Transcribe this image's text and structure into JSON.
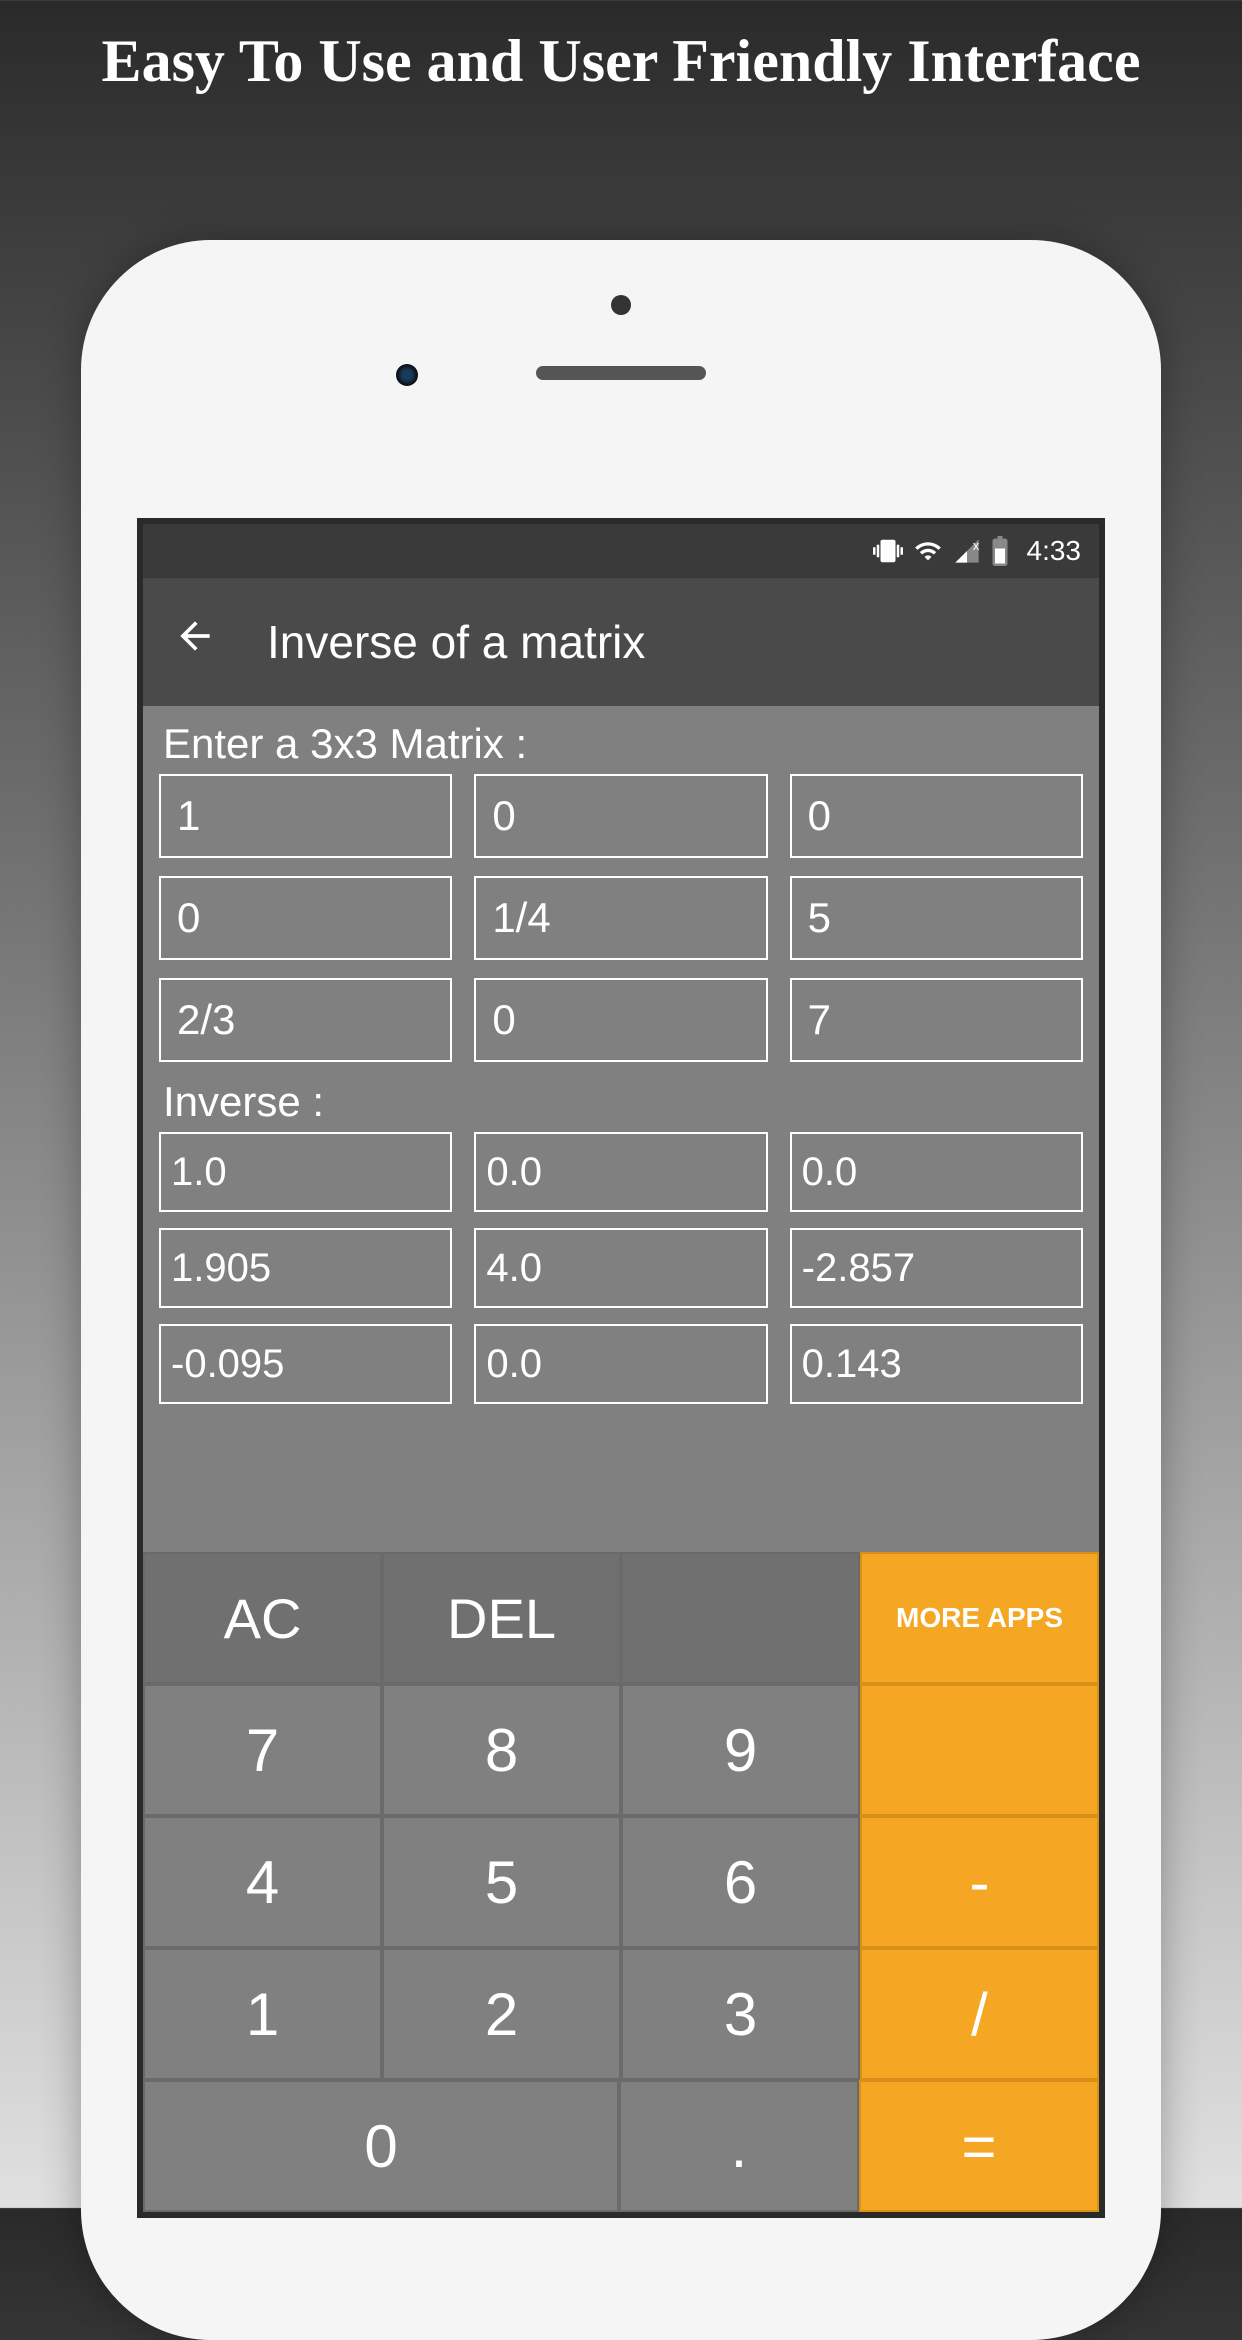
{
  "headline": "Easy To Use and User Friendly Interface",
  "status_bar": {
    "time": "4:33"
  },
  "app_bar": {
    "title": "Inverse of a matrix"
  },
  "content": {
    "input_label": "Enter a 3x3 Matrix :",
    "input_matrix": [
      [
        "1",
        "0",
        "0"
      ],
      [
        "0",
        "1/4",
        "5"
      ],
      [
        "2/3",
        "0",
        "7"
      ]
    ],
    "result_label": "Inverse :",
    "result_matrix": [
      [
        "1.0",
        "0.0",
        "0.0"
      ],
      [
        "1.905",
        "4.0",
        "-2.857"
      ],
      [
        "-0.095",
        "0.0",
        "0.143"
      ]
    ]
  },
  "keypad": {
    "ac": "AC",
    "del": "DEL",
    "more_apps": "MORE APPS",
    "k7": "7",
    "k8": "8",
    "k9": "9",
    "k4": "4",
    "k5": "5",
    "k6": "6",
    "k1": "1",
    "k2": "2",
    "k3": "3",
    "k0": "0",
    "dot": ".",
    "minus": "-",
    "slash": "/",
    "equals": "="
  }
}
